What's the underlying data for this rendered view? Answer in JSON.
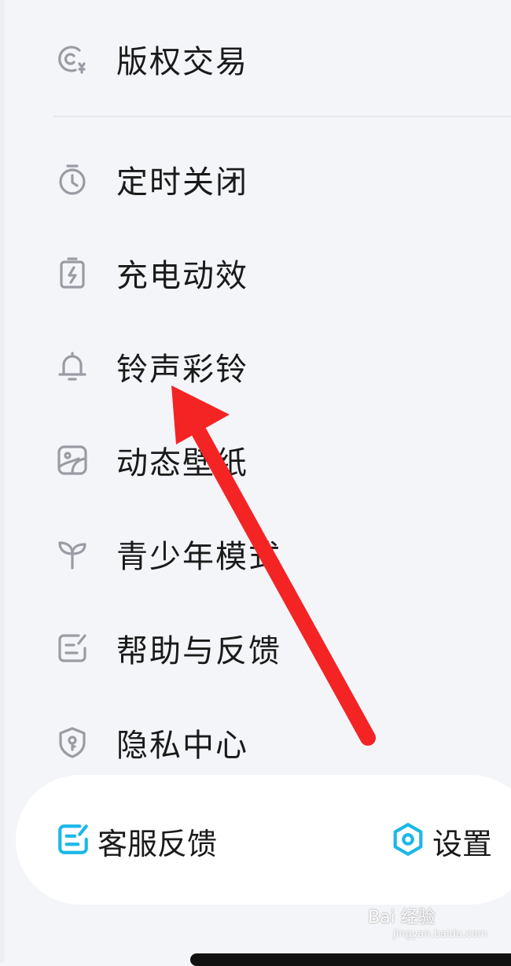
{
  "menu": {
    "items": [
      {
        "label": "版权交易",
        "icon": "copyright-icon"
      },
      {
        "label": "定时关闭",
        "icon": "timer-icon"
      },
      {
        "label": "充电动效",
        "icon": "charging-icon"
      },
      {
        "label": "铃声彩铃",
        "icon": "bell-icon"
      },
      {
        "label": "动态壁纸",
        "icon": "wallpaper-icon"
      },
      {
        "label": "青少年模式",
        "icon": "sprout-icon"
      },
      {
        "label": "帮助与反馈",
        "icon": "feedback-icon"
      },
      {
        "label": "隐私中心",
        "icon": "privacy-shield-icon"
      }
    ]
  },
  "bottom_bar": {
    "service_label": "客服反馈",
    "settings_label": "设置"
  },
  "watermark": {
    "text": "Bai 经验",
    "sub": "jingyan.baidu.com"
  },
  "colors": {
    "background": "#f4f5f9",
    "icon_gray": "#9a9ca3",
    "accent_cyan": "#1bb8e8",
    "arrow_red": "#f42424"
  }
}
